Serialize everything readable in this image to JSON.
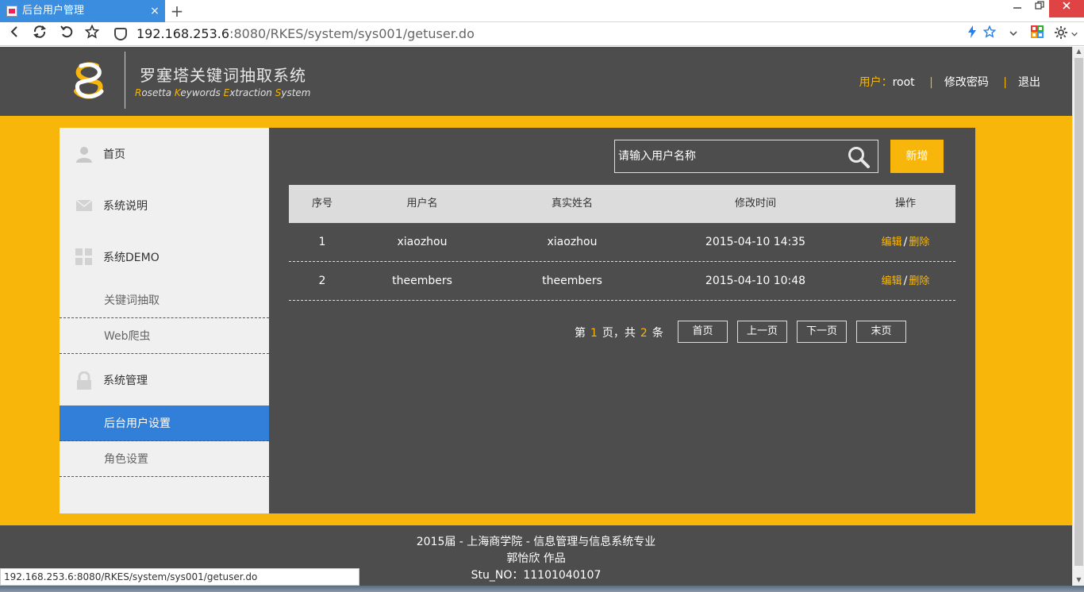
{
  "browser": {
    "tab_title": "后台用户管理",
    "tab_close": "×",
    "new_tab": "+",
    "url_host": "192.168.253.6",
    "url_rest": ":8080/RKES/system/sys001/getuser.do",
    "status_url": "192.168.253.6:8080/RKES/system/sys001/getuser.do"
  },
  "header": {
    "title": "罗塞塔关键词抽取系统",
    "subtitle_parts": [
      {
        "cap": "R",
        "rest": "osetta "
      },
      {
        "cap": "K",
        "rest": "eywords "
      },
      {
        "cap": "E",
        "rest": "xtraction "
      },
      {
        "cap": "S",
        "rest": "ystem"
      }
    ],
    "user_label": "用户：",
    "user_name": "root",
    "sep": "|",
    "change_password": "修改密码",
    "logout": "退出"
  },
  "sidebar": {
    "home": "首页",
    "system_desc": "系统说明",
    "system_demo": "系统DEMO",
    "keyword_extract": "关键词抽取",
    "web_crawler": "Web爬虫",
    "system_manage": "系统管理",
    "user_settings": "后台用户设置",
    "role_settings": "角色设置"
  },
  "search": {
    "placeholder": "请输入用户名称",
    "add_label": "新增"
  },
  "table": {
    "headers": [
      "序号",
      "用户名",
      "真实姓名",
      "修改时间",
      "操作"
    ],
    "rows": [
      {
        "index": "1",
        "username": "xiaozhou",
        "realname": "xiaozhou",
        "modified": "2015-04-10 14:35",
        "edit": "编辑",
        "delete": "删除"
      },
      {
        "index": "2",
        "username": "theembers",
        "realname": "theembers",
        "modified": "2015-04-10 10:48",
        "edit": "编辑",
        "delete": "删除"
      }
    ],
    "action_sep": "/"
  },
  "pager": {
    "prefix": "第",
    "current_page": "1",
    "mid": "页，共",
    "total": "2",
    "suffix": "条",
    "first": "首页",
    "prev": "上一页",
    "next": "下一页",
    "last": "末页"
  },
  "footer": {
    "line1": "2015届 - 上海商学院 - 信息管理与信息系统专业",
    "line2": "郭怡欣 作品",
    "line3": "Stu_NO：11101040107"
  },
  "colors": {
    "accent": "#f8b60a",
    "dark": "#4d4d4d",
    "active_blue": "#317fd9"
  }
}
